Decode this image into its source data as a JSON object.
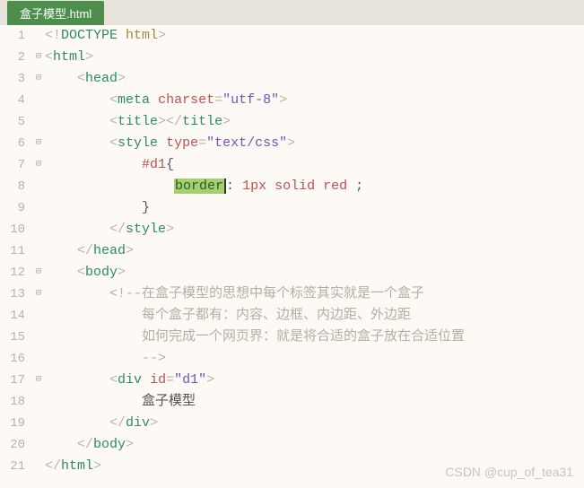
{
  "tab": {
    "title": "盒子模型.html"
  },
  "lines": [
    {
      "num": "1",
      "fold": "",
      "segments": [
        {
          "cls": "c-punc",
          "t": "<!"
        },
        {
          "cls": "c-tag",
          "t": "DOCTYPE"
        },
        {
          "cls": "",
          "t": " "
        },
        {
          "cls": "c-dkw",
          "t": "html"
        },
        {
          "cls": "c-punc",
          "t": ">"
        }
      ],
      "indent": 0
    },
    {
      "num": "2",
      "fold": "⊟",
      "segments": [
        {
          "cls": "c-punc",
          "t": "<"
        },
        {
          "cls": "c-tag",
          "t": "html"
        },
        {
          "cls": "c-punc",
          "t": ">"
        }
      ],
      "indent": 0
    },
    {
      "num": "3",
      "fold": "⊟",
      "segments": [
        {
          "cls": "c-punc",
          "t": "<"
        },
        {
          "cls": "c-tag",
          "t": "head"
        },
        {
          "cls": "c-punc",
          "t": ">"
        }
      ],
      "indent": 1
    },
    {
      "num": "4",
      "fold": "",
      "segments": [
        {
          "cls": "c-punc",
          "t": "<"
        },
        {
          "cls": "c-tag",
          "t": "meta"
        },
        {
          "cls": "",
          "t": " "
        },
        {
          "cls": "c-attr",
          "t": "charset"
        },
        {
          "cls": "c-punc",
          "t": "="
        },
        {
          "cls": "c-str",
          "t": "\"utf-8\""
        },
        {
          "cls": "c-punc",
          "t": ">"
        }
      ],
      "indent": 2
    },
    {
      "num": "5",
      "fold": "",
      "segments": [
        {
          "cls": "c-punc",
          "t": "<"
        },
        {
          "cls": "c-tag",
          "t": "title"
        },
        {
          "cls": "c-punc",
          "t": "></"
        },
        {
          "cls": "c-tag",
          "t": "title"
        },
        {
          "cls": "c-punc",
          "t": ">"
        }
      ],
      "indent": 2
    },
    {
      "num": "6",
      "fold": "⊟",
      "segments": [
        {
          "cls": "c-punc",
          "t": "<"
        },
        {
          "cls": "c-tag",
          "t": "style"
        },
        {
          "cls": "",
          "t": " "
        },
        {
          "cls": "c-attr",
          "t": "type"
        },
        {
          "cls": "c-punc",
          "t": "="
        },
        {
          "cls": "c-str",
          "t": "\"text/css\""
        },
        {
          "cls": "c-punc",
          "t": ">"
        }
      ],
      "indent": 2
    },
    {
      "num": "7",
      "fold": "⊟",
      "segments": [
        {
          "cls": "c-sel",
          "t": "#d1"
        },
        {
          "cls": "c-text",
          "t": "{"
        }
      ],
      "indent": 3
    },
    {
      "num": "8",
      "fold": "",
      "segments": [
        {
          "cls": "hl caret",
          "t": "border"
        },
        {
          "cls": "c-text",
          "t": ": "
        },
        {
          "cls": "c-num",
          "t": "1px"
        },
        {
          "cls": "c-text",
          "t": " "
        },
        {
          "cls": "c-val",
          "t": "solid"
        },
        {
          "cls": "c-text",
          "t": " "
        },
        {
          "cls": "c-val",
          "t": "red"
        },
        {
          "cls": "c-text",
          "t": " ;"
        }
      ],
      "indent": 4
    },
    {
      "num": "9",
      "fold": "",
      "segments": [
        {
          "cls": "c-text",
          "t": "}"
        }
      ],
      "indent": 3
    },
    {
      "num": "10",
      "fold": "",
      "segments": [
        {
          "cls": "c-punc",
          "t": "</"
        },
        {
          "cls": "c-tag",
          "t": "style"
        },
        {
          "cls": "c-punc",
          "t": ">"
        }
      ],
      "indent": 2
    },
    {
      "num": "11",
      "fold": "",
      "segments": [
        {
          "cls": "c-punc",
          "t": "</"
        },
        {
          "cls": "c-tag",
          "t": "head"
        },
        {
          "cls": "c-punc",
          "t": ">"
        }
      ],
      "indent": 1
    },
    {
      "num": "12",
      "fold": "⊟",
      "segments": [
        {
          "cls": "c-punc",
          "t": "<"
        },
        {
          "cls": "c-tag",
          "t": "body"
        },
        {
          "cls": "c-punc",
          "t": ">"
        }
      ],
      "indent": 1
    },
    {
      "num": "13",
      "fold": "⊟",
      "segments": [
        {
          "cls": "c-comment",
          "t": "<!--在盒子模型的思想中每个标签其实就是一个盒子"
        }
      ],
      "indent": 2
    },
    {
      "num": "14",
      "fold": "",
      "segments": [
        {
          "cls": "c-comment",
          "t": "每个盒子都有：内容、边框、内边距、外边距"
        }
      ],
      "indent": 3
    },
    {
      "num": "15",
      "fold": "",
      "segments": [
        {
          "cls": "c-comment",
          "t": "如何完成一个网页界：就是将合适的盒子放在合适位置"
        }
      ],
      "indent": 3
    },
    {
      "num": "16",
      "fold": "",
      "segments": [
        {
          "cls": "c-comment",
          "t": "-->"
        }
      ],
      "indent": 3
    },
    {
      "num": "17",
      "fold": "⊟",
      "segments": [
        {
          "cls": "c-punc",
          "t": "<"
        },
        {
          "cls": "c-tag",
          "t": "div"
        },
        {
          "cls": "",
          "t": " "
        },
        {
          "cls": "c-attr",
          "t": "id"
        },
        {
          "cls": "c-punc",
          "t": "="
        },
        {
          "cls": "c-str",
          "t": "\"d1\""
        },
        {
          "cls": "c-punc",
          "t": ">"
        }
      ],
      "indent": 2
    },
    {
      "num": "18",
      "fold": "",
      "segments": [
        {
          "cls": "c-text",
          "t": "盒子模型"
        }
      ],
      "indent": 3
    },
    {
      "num": "19",
      "fold": "",
      "segments": [
        {
          "cls": "c-punc",
          "t": "</"
        },
        {
          "cls": "c-tag",
          "t": "div"
        },
        {
          "cls": "c-punc",
          "t": ">"
        }
      ],
      "indent": 2
    },
    {
      "num": "20",
      "fold": "",
      "segments": [
        {
          "cls": "c-punc",
          "t": "</"
        },
        {
          "cls": "c-tag",
          "t": "body"
        },
        {
          "cls": "c-punc",
          "t": ">"
        }
      ],
      "indent": 1
    },
    {
      "num": "21",
      "fold": "",
      "segments": [
        {
          "cls": "c-punc",
          "t": "</"
        },
        {
          "cls": "c-tag",
          "t": "html"
        },
        {
          "cls": "c-punc",
          "t": ">"
        }
      ],
      "indent": 0
    }
  ],
  "watermark": "CSDN @cup_of_tea31"
}
